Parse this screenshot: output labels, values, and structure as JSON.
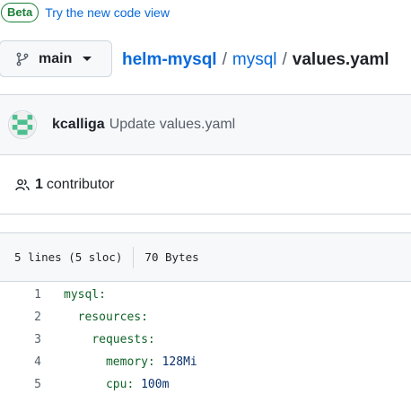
{
  "banner": {
    "badge": "Beta",
    "link_text": "Try the new code view"
  },
  "branch": {
    "name": "main",
    "icon": "git-branch-icon"
  },
  "breadcrumb": {
    "repo": "helm-mysql",
    "sep1": "/",
    "dir": "mysql",
    "sep2": "/",
    "file": "values.yaml"
  },
  "commit": {
    "author": "kcalliga",
    "message": "Update values.yaml"
  },
  "contributors": {
    "count": "1",
    "label": "contributor",
    "icon": "people-icon"
  },
  "file_info": {
    "lines": "5 lines (5 sloc)",
    "size": "70 Bytes"
  },
  "code": {
    "lines": [
      {
        "num": "1",
        "indent": "",
        "key": "mysql:",
        "value": ""
      },
      {
        "num": "2",
        "indent": "  ",
        "key": "resources:",
        "value": ""
      },
      {
        "num": "3",
        "indent": "    ",
        "key": "requests:",
        "value": ""
      },
      {
        "num": "4",
        "indent": "      ",
        "key": "memory:",
        "value": " 128Mi"
      },
      {
        "num": "5",
        "indent": "      ",
        "key": "cpu:",
        "value": " 100m"
      }
    ]
  },
  "colors": {
    "link": "#0969da",
    "badge_green": "#1a7f37",
    "yaml_key": "#116329",
    "yaml_value": "#0a3069"
  }
}
